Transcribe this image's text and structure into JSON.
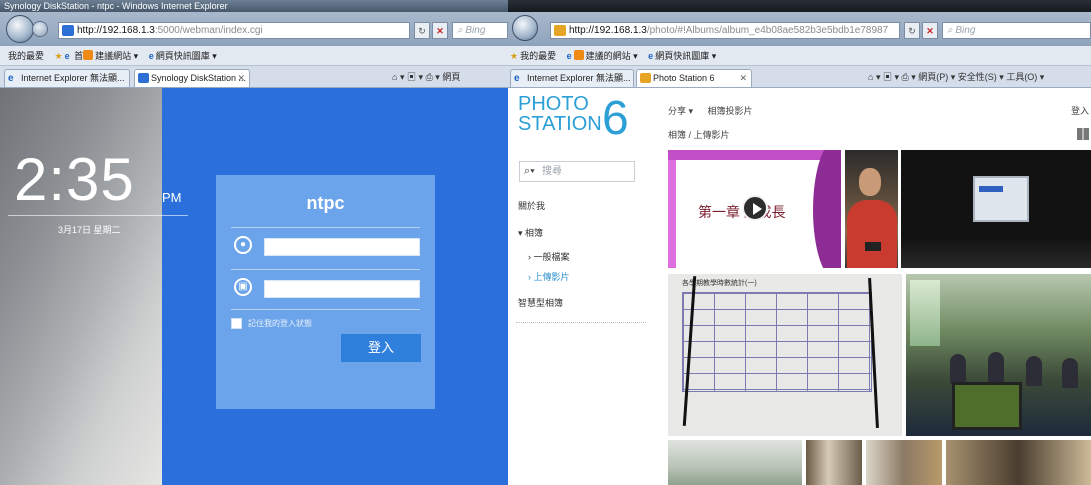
{
  "left_window": {
    "title": "Synology DiskStation - ntpc - Windows Internet Explorer",
    "url_host": "http://192.168.1.3",
    "url_rest": ":5000/webman/index.cgi",
    "search_placeholder": "Bing",
    "favorites": [
      "我的最愛",
      "建議網站 ▾",
      "網頁快訊圖庫 ▾"
    ],
    "tabs": [
      "Internet Explorer 無法顯...",
      "Synology DiskStation ..."
    ],
    "command_items": [
      "▾",
      "▾",
      "▾",
      "網頁"
    ],
    "clock": {
      "time": "2:35",
      "ampm": "PM",
      "date": "3月17日 星期二"
    },
    "login": {
      "host": "ntpc",
      "username_value": "",
      "password_value": "",
      "remember_label": "記住我的登入狀態",
      "submit_label": "登入"
    }
  },
  "right_window": {
    "url_host": "http://192.168.1.3",
    "url_rest": "/photo/#!Albums/album_e4b08ae582b3e5bdb1e78987",
    "search_placeholder": "Bing",
    "favorites": [
      "我的最愛",
      "建議的網站 ▾",
      "網頁快訊圖庫 ▾"
    ],
    "tabs": [
      "Internet Explorer 無法顯...",
      "Photo Station 6"
    ],
    "command_items": [
      "網頁(P) ▾",
      "安全性(S) ▾",
      "工具(O) ▾"
    ],
    "logo": {
      "text_top": "PHOTO",
      "text_bottom": "STATION",
      "number": "6"
    },
    "search_placeholder_ps": "搜尋",
    "sidebar": [
      "關於我",
      "▾ 相簿",
      "› 一般檔案",
      "› 上傳影片",
      "智慧型相簿"
    ],
    "topmenu": [
      "分享 ▾",
      "相簿投影片"
    ],
    "login_link": "登入",
    "breadcrumb": "相簿 / 上傳影片",
    "slide_text": "第一章  的成長",
    "table_title": "各學期教學時數統計(一)"
  }
}
